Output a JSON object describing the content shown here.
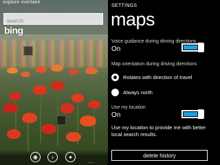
{
  "left_screen": {
    "title": "explore overlake",
    "search": {
      "placeholder": "search",
      "value": ""
    },
    "logo": "bing",
    "appbar": {
      "buttons": [
        {
          "icon": "eye-icon",
          "glyph": "◉"
        },
        {
          "icon": "music-note-icon",
          "glyph": "♪"
        },
        {
          "icon": "microphone-icon",
          "glyph": "●"
        }
      ],
      "more": "..."
    }
  },
  "settings": {
    "header": "SETTINGS",
    "title": "maps",
    "voice_guidance": {
      "label": "Voice guidance during driving directions",
      "value": "On",
      "on": true
    },
    "orientation": {
      "label": "Map orientation during driving directions",
      "options": [
        {
          "label": "Rotates with direction of travel",
          "selected": true
        },
        {
          "label": "Always north",
          "selected": false
        }
      ]
    },
    "location": {
      "label": "Use my location",
      "value": "On",
      "on": true
    },
    "location_description": "Use my location to provide me with better local search results.",
    "delete_history_label": "delete history",
    "colors": {
      "accent": "#1ba1e2",
      "background": "#000000",
      "text": "#ffffff"
    }
  }
}
